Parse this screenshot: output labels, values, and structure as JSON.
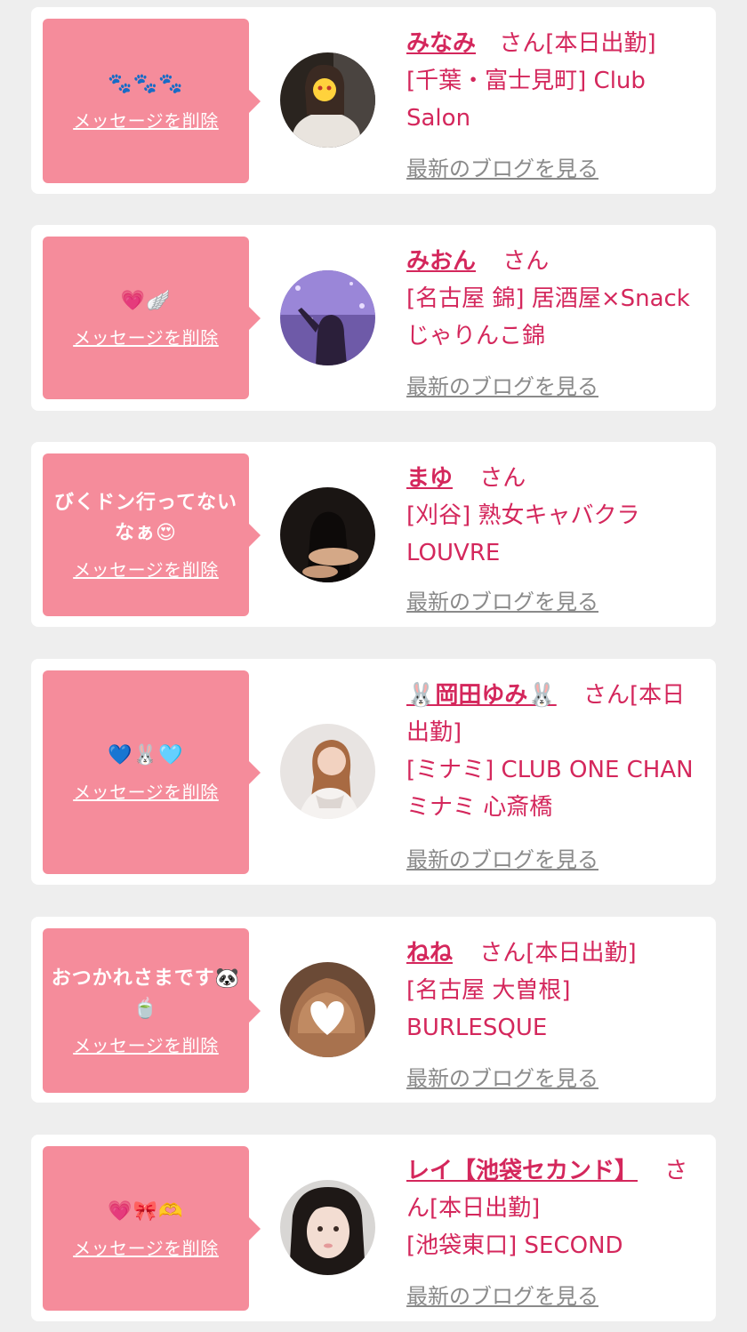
{
  "cards": [
    {
      "message": "🐾🐾🐾",
      "delete_label": "メッセージを削除",
      "name": "みなみ",
      "san": "さん",
      "status": "[本日出勤]",
      "shop": "[千葉・富士見町] Club Salon",
      "blog_label": "最新のブログを見る",
      "avatar_color": "#2a241f"
    },
    {
      "message": "💗🪽",
      "delete_label": "メッセージを削除",
      "name": "みおん",
      "san": "さん",
      "status": "",
      "shop": "[名古屋 錦] 居酒屋×Snack じゃりんこ錦",
      "blog_label": "最新のブログを見る",
      "avatar_color": "#6e5aa8"
    },
    {
      "message": "びくドン行ってないなぁ😍",
      "delete_label": "メッセージを削除",
      "name": "まゆ",
      "san": "さん",
      "status": "",
      "shop": "[刈谷] 熟女キャバクラ LOUVRE",
      "blog_label": "最新のブログを見る",
      "avatar_color": "#1a1513"
    },
    {
      "message": "💙🐰🩵",
      "delete_label": "メッセージを削除",
      "name": "🐰岡田ゆみ🐰",
      "san": "さん",
      "status": "[本日出勤]",
      "shop": "[ミナミ] CLUB ONE CHAN ミナミ 心斎橋",
      "blog_label": "最新のブログを見る",
      "avatar_color": "#e8dcd6"
    },
    {
      "message": "おつかれさまです🐼🍵",
      "delete_label": "メッセージを削除",
      "name": "ねね",
      "san": "さん",
      "status": "[本日出勤]",
      "shop": "[名古屋 大曽根] BURLESQUE",
      "blog_label": "最新のブログを見る",
      "avatar_color": "#8b5a3c"
    },
    {
      "message": "💗🎀🫶",
      "delete_label": "メッセージを削除",
      "name": "レイ【池袋セカンド】",
      "san": "さん",
      "status": "[本日出勤]",
      "shop": "[池袋東口] SECOND",
      "blog_label": "最新のブログを見る",
      "avatar_color": "#3a3330"
    }
  ],
  "colors": {
    "accent": "#d4275c",
    "bubble": "#f58c9b",
    "link_gray": "#8a8a8a",
    "background": "#eeeeee"
  }
}
